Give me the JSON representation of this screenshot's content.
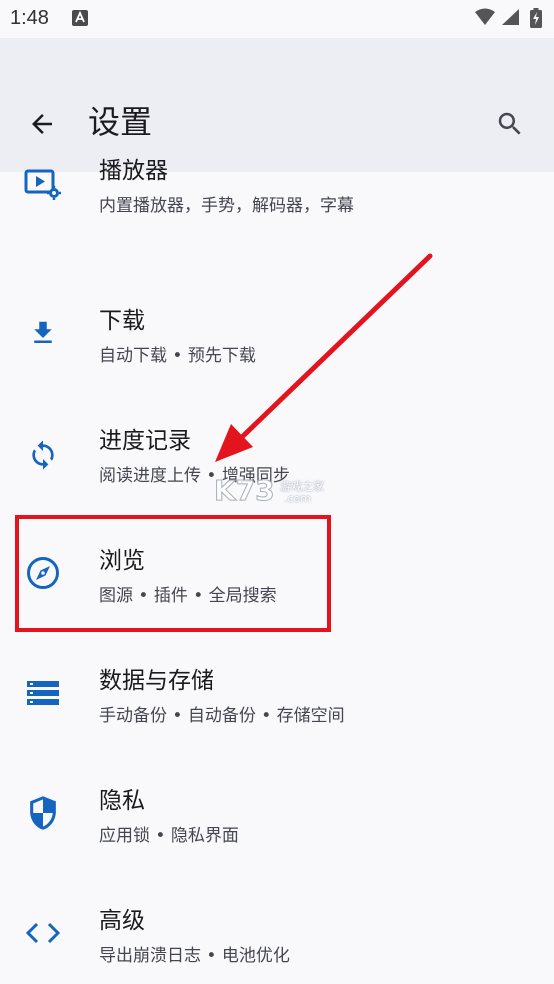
{
  "status_bar": {
    "time": "1:48"
  },
  "toolbar": {
    "title": "设置"
  },
  "settings": [
    {
      "title": "播放器",
      "subtitle": "内置播放器，手势，解码器，字幕",
      "icon": "player-settings-icon"
    },
    {
      "title": "下载",
      "subtitle": "自动下载 • 预先下载",
      "icon": "download-icon"
    },
    {
      "title": "进度记录",
      "subtitle": "阅读进度上传 • 增强同步",
      "icon": "sync-icon"
    },
    {
      "title": "浏览",
      "subtitle": "图源 • 插件 • 全局搜索",
      "icon": "compass-icon"
    },
    {
      "title": "数据与存储",
      "subtitle": "手动备份 • 自动备份 • 存储空间",
      "icon": "storage-icon"
    },
    {
      "title": "隐私",
      "subtitle": "应用锁 • 隐私界面",
      "icon": "shield-icon"
    },
    {
      "title": "高级",
      "subtitle": "导出崩溃日志 • 电池优化",
      "icon": "code-icon"
    }
  ],
  "watermark": {
    "logo_text": "K73",
    "site_text": "游戏之家",
    "domain_text": ".com"
  },
  "colors": {
    "accent": "#1565c0",
    "annotation": "#e3141d",
    "toolbar_bg": "#ededf4",
    "page_bg": "#f9f9fc"
  }
}
